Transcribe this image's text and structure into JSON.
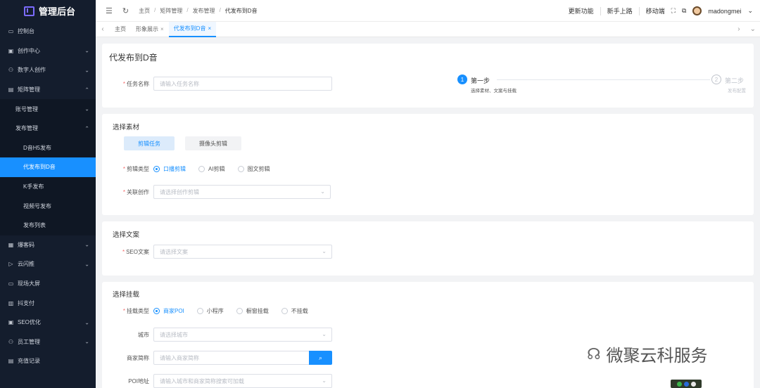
{
  "app": {
    "title": "管理后台"
  },
  "sidebar": {
    "items": [
      {
        "label": "控制台",
        "icon": "monitor-icon"
      },
      {
        "label": "创作中心",
        "icon": "calendar-icon"
      },
      {
        "label": "数字人创作",
        "icon": "person-icon"
      },
      {
        "label": "矩阵管理",
        "icon": "grid-icon"
      },
      {
        "label": "账号管理"
      },
      {
        "label": "发布管理"
      },
      {
        "label": "D音H5发布"
      },
      {
        "label": "代发布到D音"
      },
      {
        "label": "K手发布"
      },
      {
        "label": "视频号发布"
      },
      {
        "label": "发布列表"
      },
      {
        "label": "爆客码",
        "icon": "qrcode-icon"
      },
      {
        "label": "云闪推",
        "icon": "video-icon"
      },
      {
        "label": "现场大屏",
        "icon": "screen-icon"
      },
      {
        "label": "抖支付",
        "icon": "pay-icon"
      },
      {
        "label": "SEO优化",
        "icon": "seo-icon"
      },
      {
        "label": "员工管理",
        "icon": "staff-icon"
      },
      {
        "label": "充值记录",
        "icon": "wallet-icon"
      }
    ]
  },
  "topbar": {
    "breadcrumb": [
      "主页",
      "矩阵管理",
      "发布管理",
      "代发布到D音"
    ],
    "links": [
      "更新功能",
      "新手上路",
      "移动端"
    ],
    "user": "madongmei"
  },
  "tabs": [
    {
      "label": "主页"
    },
    {
      "label": "形象展示"
    },
    {
      "label": "代发布到D音"
    }
  ],
  "page": {
    "title": "代发布到D音",
    "task_name_label": "任务名称",
    "task_name_placeholder": "请输入任务名称",
    "steps": [
      {
        "num": "1",
        "title": "第一步",
        "desc": "选择素材、文案与挂载"
      },
      {
        "num": "2",
        "title": "第二步",
        "desc": "发布配置"
      }
    ]
  },
  "material": {
    "title": "选择素材",
    "tabs": [
      "剪辑任务",
      "摄像头剪辑"
    ],
    "edit_type_label": "剪辑类型",
    "edit_types": [
      "口播剪辑",
      "AI剪辑",
      "图文剪辑"
    ],
    "related_label": "关联创作",
    "related_placeholder": "请选择创作剪辑"
  },
  "copy": {
    "title": "选择文案",
    "seo_label": "SEO文案",
    "seo_placeholder": "请选择文案"
  },
  "mount": {
    "title": "选择挂载",
    "type_label": "挂载类型",
    "types": [
      "商家POI",
      "小程序",
      "橱窗挂载",
      "不挂载"
    ],
    "city_label": "城市",
    "city_placeholder": "请选择城市",
    "merchant_label": "商家简称",
    "merchant_placeholder": "请输入商家简称",
    "poi_label": "POI地址",
    "poi_placeholder": "请输入城市和商家简称搜索可加载"
  },
  "watermark": {
    "text": "微聚云科服务"
  },
  "colors": {
    "accent": "#1890ff",
    "sidebar": "#141d2d",
    "required": "#f56c6c"
  }
}
